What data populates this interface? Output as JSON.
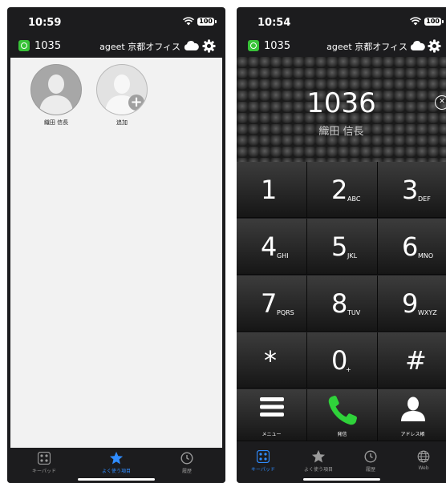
{
  "left": {
    "status": {
      "time": "10:59",
      "battery": "100"
    },
    "appbar": {
      "extension": "1035",
      "office": "ageet 京都オフィス"
    },
    "favorites": [
      {
        "name": "織田 信長"
      },
      {
        "name": "追加"
      }
    ],
    "tabs": [
      {
        "label": "キーパッド",
        "icon": "keypad-icon"
      },
      {
        "label": "よく使う項目",
        "icon": "star-icon"
      },
      {
        "label": "履歴",
        "icon": "clock-icon"
      }
    ],
    "active_tab": "よく使う項目"
  },
  "right": {
    "status": {
      "time": "10:54",
      "battery": "100"
    },
    "appbar": {
      "extension": "1035",
      "office": "ageet 京都オフィス"
    },
    "display": {
      "number": "1036",
      "name": "織田 信長"
    },
    "keys": [
      {
        "digit": "1",
        "letters": ""
      },
      {
        "digit": "2",
        "letters": "ABC"
      },
      {
        "digit": "3",
        "letters": "DEF"
      },
      {
        "digit": "4",
        "letters": "GHI"
      },
      {
        "digit": "5",
        "letters": "JKL"
      },
      {
        "digit": "6",
        "letters": "MNO"
      },
      {
        "digit": "7",
        "letters": "PQRS"
      },
      {
        "digit": "8",
        "letters": "TUV"
      },
      {
        "digit": "9",
        "letters": "WXYZ"
      },
      {
        "digit": "*",
        "letters": ""
      },
      {
        "digit": "0",
        "letters": "+"
      },
      {
        "digit": "#",
        "letters": ""
      }
    ],
    "actions": [
      {
        "label": "メニュー",
        "icon": "menu-icon"
      },
      {
        "label": "発信",
        "icon": "phone-icon"
      },
      {
        "label": "アドレス帳",
        "icon": "contact-icon"
      }
    ],
    "tabs": [
      {
        "label": "キーパッド",
        "icon": "keypad-icon"
      },
      {
        "label": "よく使う項目",
        "icon": "star-icon"
      },
      {
        "label": "履歴",
        "icon": "clock-icon"
      },
      {
        "label": "Web",
        "icon": "globe-icon"
      }
    ],
    "active_tab": "キーパッド"
  },
  "colors": {
    "accent": "#2f8cff",
    "call_green": "#2fd23a",
    "status_green": "#38c338",
    "background_dark": "#1c1c1e"
  }
}
